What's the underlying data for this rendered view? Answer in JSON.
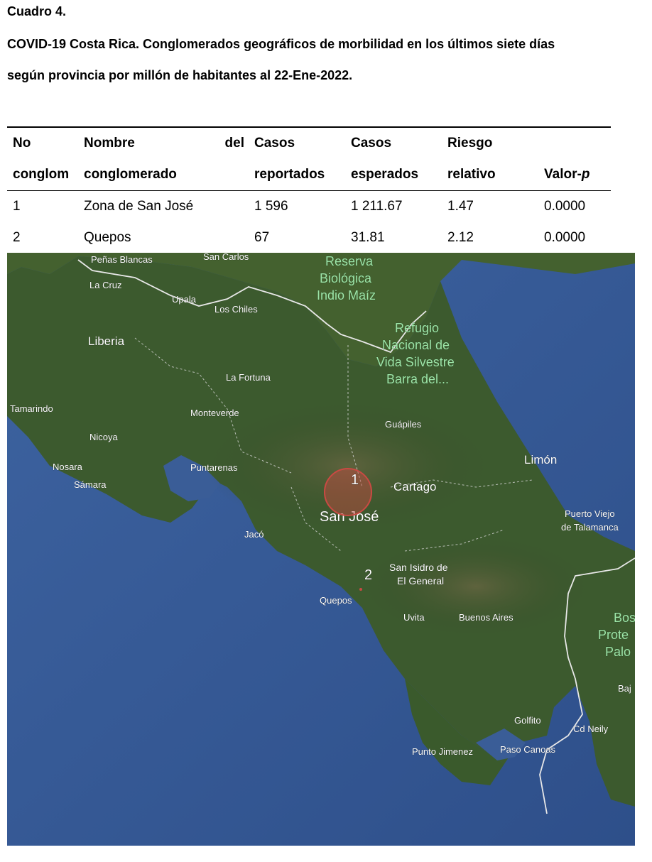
{
  "caption": {
    "number": "Cuadro 4.",
    "title_line1": "COVID-19 Costa Rica. Conglomerados geográficos de morbilidad en los últimos siete días",
    "title_line2": "según provincia por millón de habitantes al 22-Ene-2022."
  },
  "table": {
    "header_row1": [
      "No",
      "Nombre",
      "del",
      "Casos",
      "Casos",
      "Riesgo",
      ""
    ],
    "header_row2": [
      "conglom",
      "conglomerado",
      "reportados",
      "esperados",
      "relativo",
      "Valor-",
      "p"
    ],
    "rows": [
      [
        "1",
        "Zona de San José",
        "1 596",
        "1 211.67",
        "1.47",
        "0.0000"
      ],
      [
        "2",
        "Quepos",
        "67",
        "31.81",
        "2.12",
        "0.0000"
      ]
    ]
  },
  "map": {
    "labels": {
      "penas_blancas": "Peñas Blancas",
      "san_carlos": "San Carlos",
      "reserva1": "Reserva",
      "reserva2": "Biológica",
      "reserva3": "Indio Maíz",
      "la_cruz": "La Cruz",
      "upala": "Upala",
      "los_chiles": "Los Chiles",
      "refugio1": "Refugio",
      "refugio2": "Nacional de",
      "refugio3": "Vida Silvestre",
      "refugio4": "Barra del...",
      "liberia": "Liberia",
      "la_fortuna": "La Fortuna",
      "tamarindo": "Tamarindo",
      "monteverde": "Monteverde",
      "guapiles": "Guápiles",
      "nicoya": "Nicoya",
      "limon": "Limón",
      "nosara": "Nosara",
      "puntarenas": "Puntarenas",
      "samara": "Sámara",
      "cartago": "Cartago",
      "san_jose": "San José",
      "puerto_viejo1": "Puerto Viejo",
      "puerto_viejo2": "de Talamanca",
      "jaco": "Jacó",
      "san_isidro1": "San Isidro de",
      "san_isidro2": "El General",
      "quepos": "Quepos",
      "uvita": "Uvita",
      "buenos_aires": "Buenos Aires",
      "bosque1": "Bos",
      "bosque2": "Prote",
      "bosque3": "Palo",
      "baja": "Baj",
      "golfito": "Golfito",
      "cd_neily": "Cd Neily",
      "punto_jimenez": "Punto Jimenez",
      "paso_canoas": "Paso Canoas"
    },
    "clusters": [
      {
        "id": "1"
      },
      {
        "id": "2"
      }
    ]
  },
  "colors": {
    "ocean": "#3a5d97",
    "land": "#3c5a2e",
    "cluster": "#c94a43",
    "border": "#e8e8e8"
  }
}
